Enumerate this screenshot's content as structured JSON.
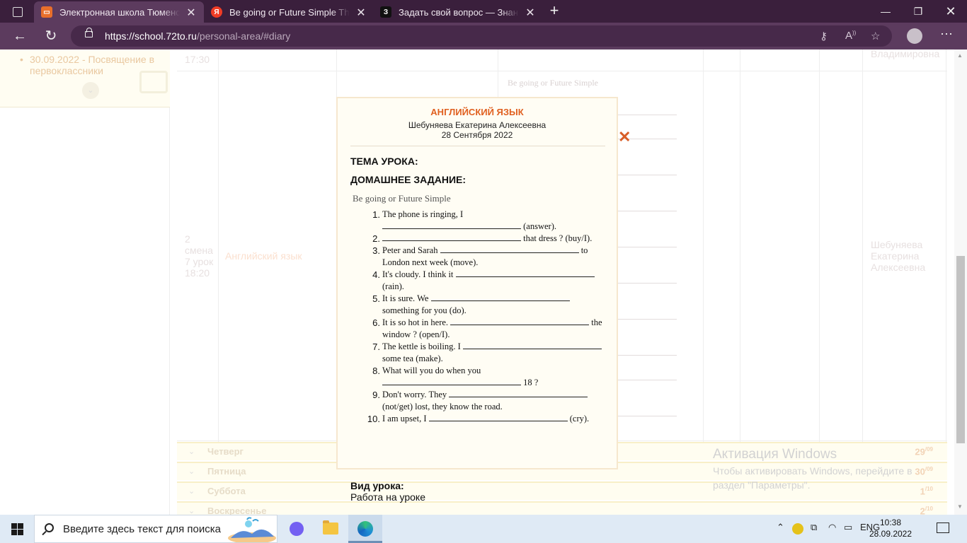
{
  "browser": {
    "tabs": [
      {
        "title": "Электронная школа Тюменской области",
        "active": true,
        "favicon": "school-icon",
        "color": "#e86f2b"
      },
      {
        "title": "Be going or Future Simple The phone is ringing",
        "active": false,
        "favicon": "yandex-icon",
        "color": "#f03c25"
      },
      {
        "title": "Задать свой вопрос — Знания.com",
        "active": false,
        "favicon": "znania-icon",
        "color": "#111111"
      }
    ],
    "url_host": "https://school.72to.ru",
    "url_path": "/personal-area/#diary"
  },
  "left_panel": {
    "news_item": "30.09.2022 - Посвящение в первоклассники"
  },
  "background_table": {
    "prev_time": "17:30",
    "prev_teacher": "Владимировна",
    "lesson_number": "2 смена 7 урок 18:20",
    "lesson_name": "Английский язык",
    "teacher": "Шебуняева Екатерина Алексеевна",
    "hw_title": "Be going or Future Simple"
  },
  "days": [
    {
      "name": "Четверг",
      "date": "29",
      "month": "09"
    },
    {
      "name": "Пятница",
      "date": "30",
      "month": "09"
    },
    {
      "name": "Суббота",
      "date": "1",
      "month": "10"
    },
    {
      "name": "Воскресенье",
      "date": "2",
      "month": "10"
    }
  ],
  "modal": {
    "subject": "АНГЛИЙСКИЙ ЯЗЫК",
    "teacher": "Шебуняева Екатерина Алексеевна",
    "date": "28 Сентября 2022",
    "topic_label": "ТЕМА УРОКА:",
    "homework_label": "ДОМАШНЕЕ ЗАДАНИЕ:",
    "homework_title": "Be going or Future Simple",
    "exercises": [
      {
        "n": "1.",
        "a": "The phone is ringing, I",
        "b": "(answer)."
      },
      {
        "n": "2.",
        "a": "",
        "b": "that dress ? (buy/I)."
      },
      {
        "n": "3.",
        "a": "Peter and Sarah",
        "b": "to London next week (move)."
      },
      {
        "n": "4.",
        "a": "It's cloudy. I think it",
        "b": "(rain)."
      },
      {
        "n": "5.",
        "a": "It is sure. We",
        "b": "something for you (do)."
      },
      {
        "n": "6.",
        "a": "It is so hot in here.",
        "b": "the window ? (open/I)."
      },
      {
        "n": "7.",
        "a": "The kettle is boiling. I",
        "b": "some tea (make)."
      },
      {
        "n": "8.",
        "a": "What will you do when you",
        "b": "18 ?"
      },
      {
        "n": "9.",
        "a": "Don't worry. They",
        "b": "(not/get) lost, they know the road."
      },
      {
        "n": "10.",
        "a": "I am upset, I",
        "b": "(cry)."
      }
    ],
    "lesson_kind_label": "Вид урока:",
    "lesson_kind": "Работа на уроке"
  },
  "watermark": {
    "title": "Активация Windows",
    "text": "Чтобы активировать Windows, перейдите в раздел \"Параметры\"."
  },
  "taskbar": {
    "search_placeholder": "Введите здесь текст для поиска",
    "lang": "ENG",
    "time": "10:38",
    "date": "28.09.2022"
  }
}
